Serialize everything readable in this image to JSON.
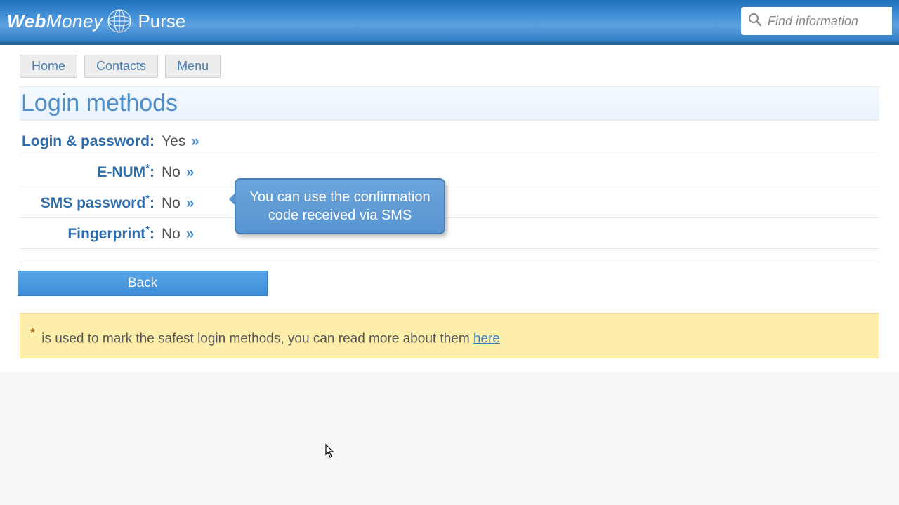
{
  "header": {
    "brand_main": "Web",
    "brand_sub": "Money",
    "product": "Purse",
    "search_placeholder": "Find information"
  },
  "nav": {
    "items": [
      "Home",
      "Contacts",
      "Menu"
    ]
  },
  "page": {
    "title": "Login methods",
    "methods": [
      {
        "label": "Login & password",
        "asterisk": false,
        "value": "Yes"
      },
      {
        "label": "E-NUM",
        "asterisk": true,
        "value": "No"
      },
      {
        "label": "SMS password",
        "asterisk": true,
        "value": "No"
      },
      {
        "label": "Fingerprint",
        "asterisk": true,
        "value": "No"
      }
    ],
    "tooltip": "You can use the confirmation code received via SMS",
    "back_button": "Back",
    "info": {
      "text": "is used to mark the safest login methods, you can read more about them ",
      "link_text": "here"
    }
  }
}
